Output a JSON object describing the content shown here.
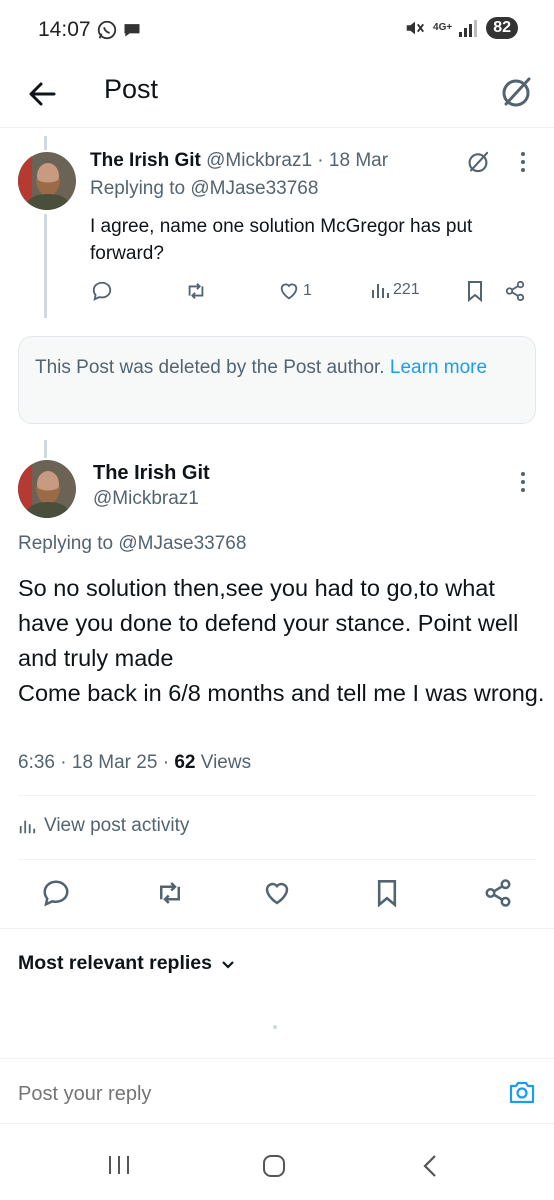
{
  "status_bar": {
    "time": "14:07",
    "network": "4G+",
    "battery": "82"
  },
  "header": {
    "title": "Post"
  },
  "parent_post": {
    "author_name": "The Irish Git",
    "author_handle": "@Mickbraz1",
    "date": "18 Mar",
    "replying_prefix": "Replying to",
    "replying_to": "@MJase33768",
    "text": "I agree, name one solution McGregor has put forward?",
    "likes": "1",
    "views": "221"
  },
  "deleted_notice": {
    "text": "This Post was deleted by the Post author.",
    "learn_more": "Learn more"
  },
  "main_post": {
    "author_name": "The Irish Git",
    "author_handle": "@Mickbraz1",
    "replying_prefix": "Replying to",
    "replying_to": "@MJase33768",
    "text": "So no solution then,see you had to go,to what have you done to defend your stance. Point well and truly made\nCome back in 6/8 months and tell me I was wrong.",
    "time": "6:36",
    "date": "18 Mar 25",
    "views_count": "62",
    "views_label": "Views",
    "activity_label": "View post activity"
  },
  "replies": {
    "sort_label": "Most relevant replies"
  },
  "composer": {
    "placeholder": "Post your reply"
  },
  "colors": {
    "accent": "#1d9bf0",
    "muted": "#536471",
    "text": "#0f1419"
  }
}
